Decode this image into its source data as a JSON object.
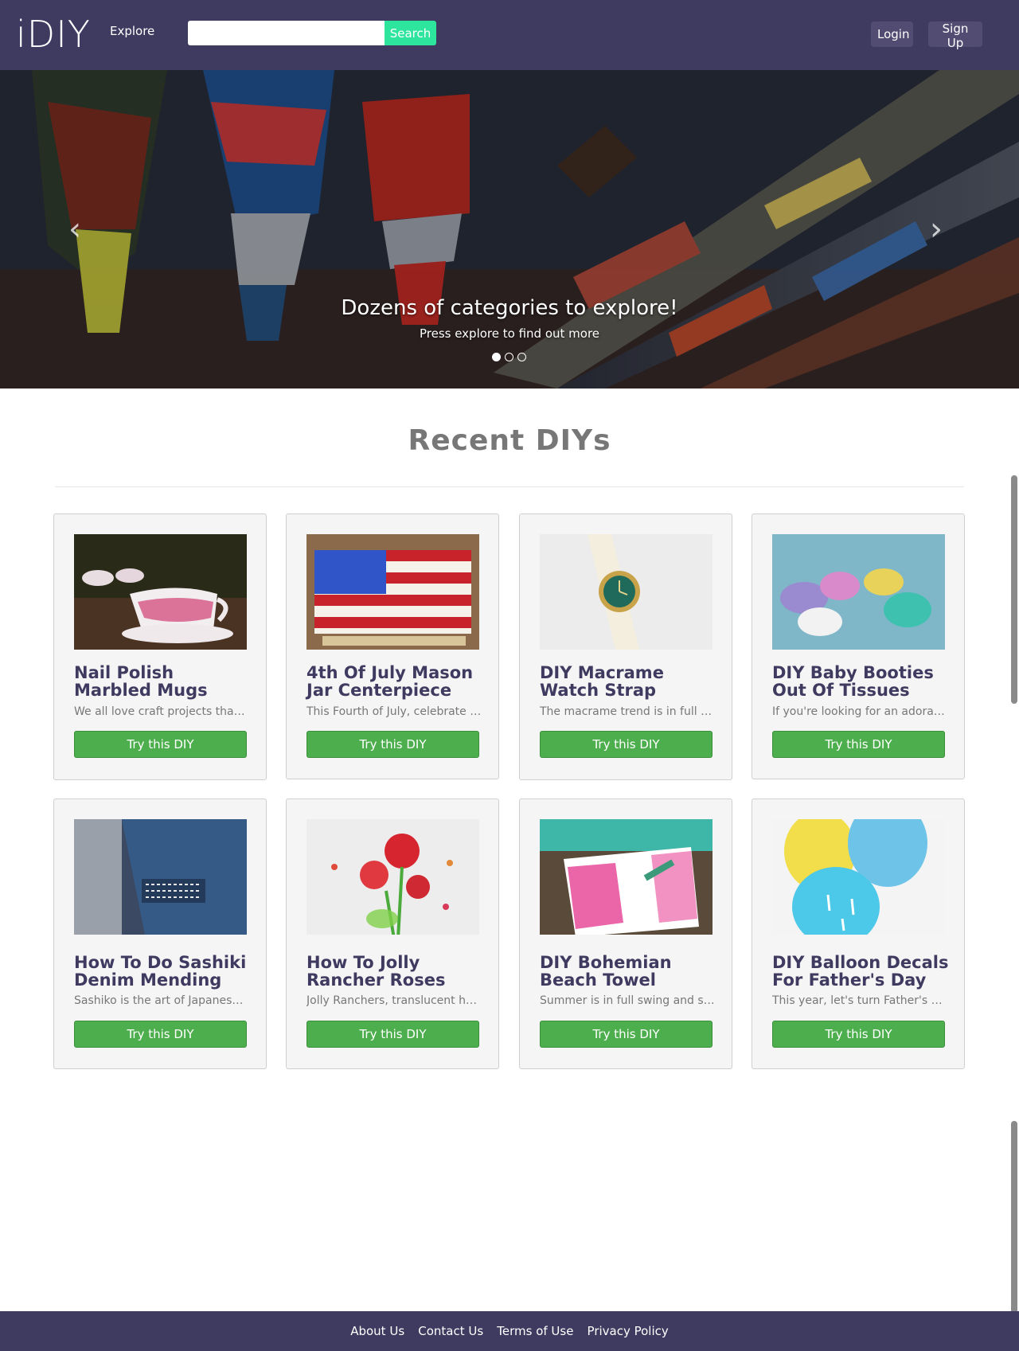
{
  "brand": {
    "logo_text": "iDIY"
  },
  "nav": {
    "explore_label": "Explore",
    "search_placeholder": "",
    "search_value": "",
    "search_button": "Search",
    "login_label": "Login",
    "signup_label": "Sign Up"
  },
  "hero": {
    "title": "Dozens of categories to explore!",
    "subtitle": "Press explore to find out more",
    "slide_count": 3,
    "active_slide": 1,
    "prev_icon": "chevron-left",
    "next_icon": "chevron-right"
  },
  "section": {
    "title": "Recent DIYs"
  },
  "cards": [
    {
      "title": "Nail Polish Marbled Mugs",
      "desc": "We all love craft projects that are easy and fun",
      "button": "Try this DIY"
    },
    {
      "title": "4th Of July Mason Jar Centerpiece",
      "desc": "This Fourth of July, celebrate with a centerpiece",
      "button": "Try this DIY"
    },
    {
      "title": "DIY Macrame Watch Strap",
      "desc": "The macrame trend is in full force this summer",
      "button": "Try this DIY"
    },
    {
      "title": "DIY Baby Booties Out Of Tissues",
      "desc": "If you're looking for an adorable baby shower idea",
      "button": "Try this DIY"
    },
    {
      "title": "How To Do Sashiki Denim Mending",
      "desc": "Sashiko is the art of Japanese embroidery",
      "button": "Try this DIY"
    },
    {
      "title": "How To Jolly Rancher Roses",
      "desc": "Jolly Ranchers, translucent hard candies",
      "button": "Try this DIY"
    },
    {
      "title": "DIY Bohemian Beach Towel",
      "desc": "Summer is in full swing and so is beach season",
      "button": "Try this DIY"
    },
    {
      "title": "DIY Balloon Decals For Father's Day",
      "desc": "This year, let's turn Father's Day into a party",
      "button": "Try this DIY"
    }
  ],
  "footer": {
    "links": [
      "About Us",
      "Contact Us",
      "Terms of Use",
      "Privacy Policy"
    ]
  },
  "colors": {
    "navbar": "#3f3a60",
    "search_button": "#2ee59d",
    "card_button": "#4cae4c",
    "card_title": "#3f3a60"
  }
}
